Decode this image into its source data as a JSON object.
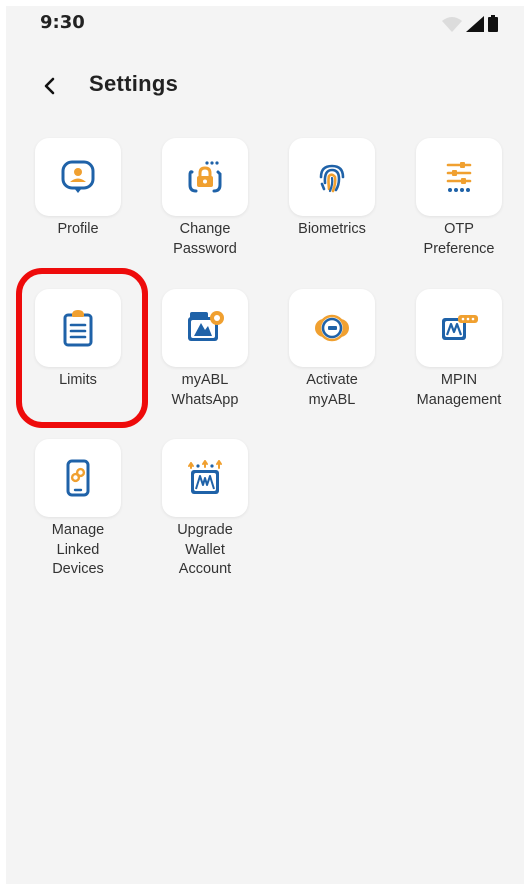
{
  "status_bar": {
    "time": "9:30"
  },
  "header": {
    "title": "Settings"
  },
  "tiles": [
    {
      "label": "Profile",
      "icon": "profile-icon"
    },
    {
      "label": "Change\nPassword",
      "icon": "lock-icon"
    },
    {
      "label": "Biometrics",
      "icon": "fingerprint-icon"
    },
    {
      "label": "OTP\nPreference",
      "icon": "otp-sliders-icon"
    },
    {
      "label": "Limits",
      "icon": "clipboard-icon"
    },
    {
      "label": "myABL\nWhatsApp",
      "icon": "myabl-whatsapp-icon"
    },
    {
      "label": "Activate\nmyABL",
      "icon": "toggle-icon"
    },
    {
      "label": "MPIN\nManagement",
      "icon": "mpin-icon"
    },
    {
      "label": "Manage\nLinked\nDevices",
      "icon": "linked-device-icon"
    },
    {
      "label": "Upgrade\nWallet\nAccount",
      "icon": "upgrade-wallet-icon"
    }
  ],
  "colors": {
    "background": "#f4f4f4",
    "tile": "#ffffff",
    "brand_blue": "#1f62a8",
    "brand_orange": "#f0a030",
    "highlight": "#ee0b0b"
  }
}
